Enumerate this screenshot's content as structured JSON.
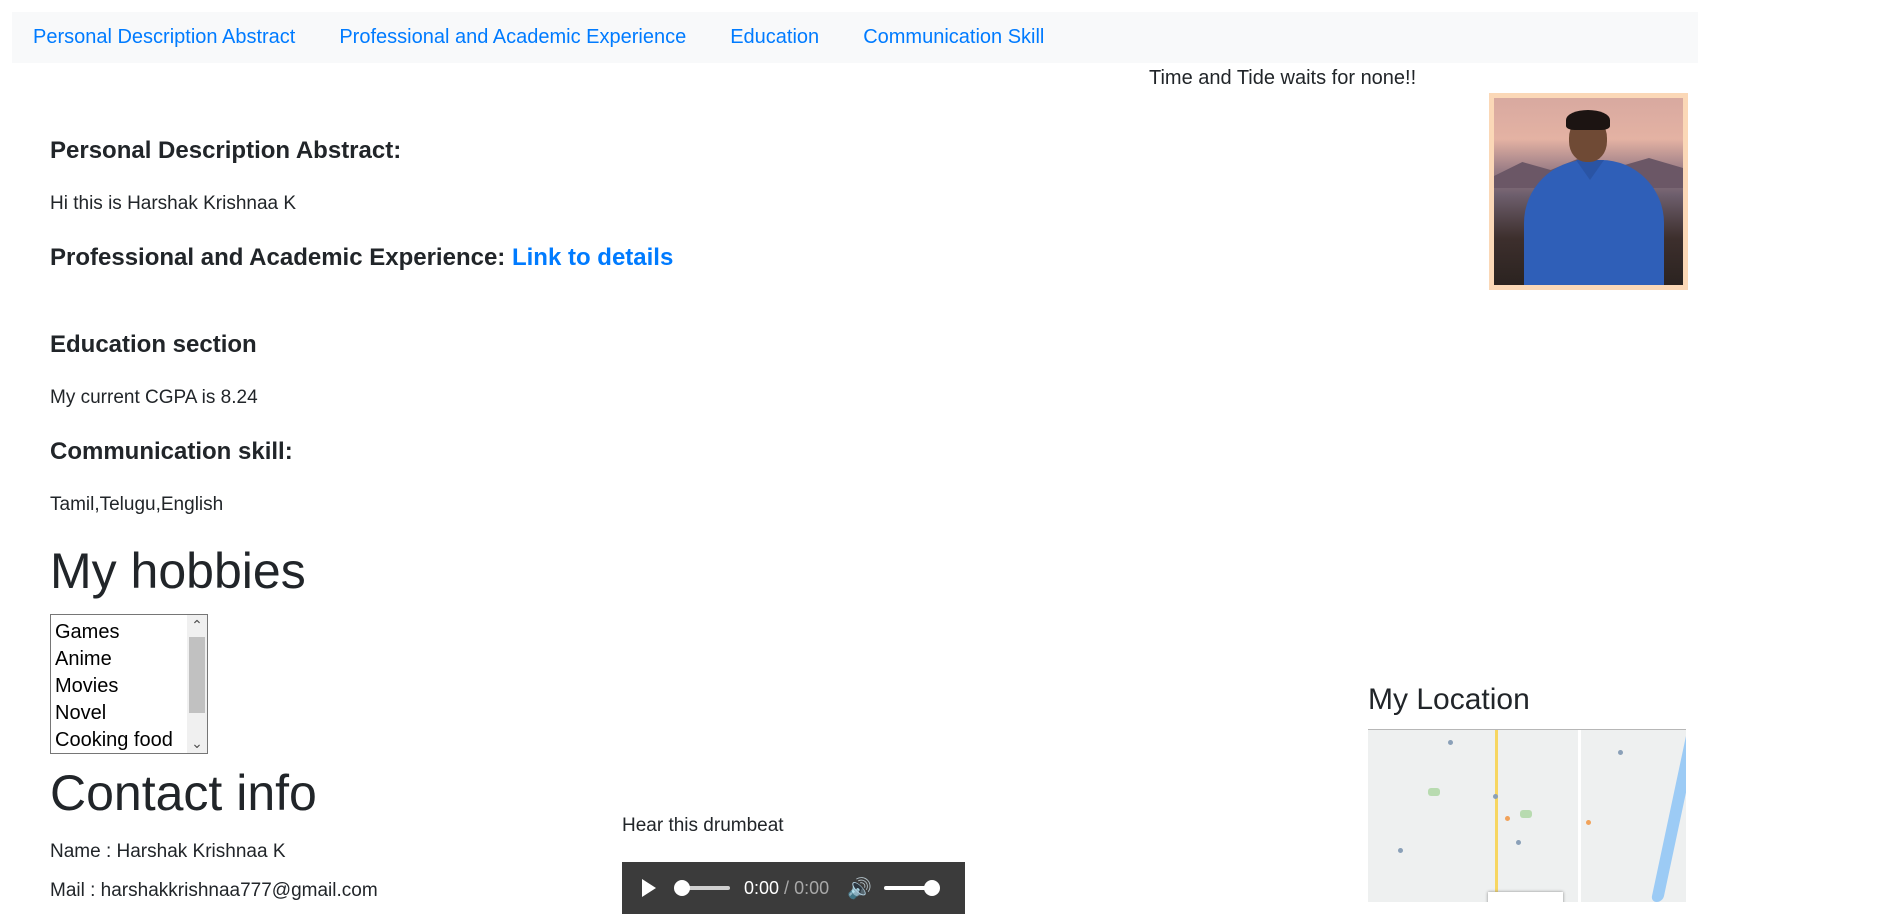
{
  "nav": {
    "items": [
      {
        "label": "Personal Description Abstract"
      },
      {
        "label": "Professional and Academic Experience"
      },
      {
        "label": "Education"
      },
      {
        "label": "Communication Skill"
      }
    ]
  },
  "quote": "Time and Tide waits for none!!",
  "sections": {
    "personal_heading": "Personal Description Abstract:",
    "personal_text": "Hi this is Harshak Krishnaa K",
    "experience_heading": "Professional and Academic Experience: ",
    "experience_link": "Link to details",
    "education_heading": "Education section",
    "education_text": "My current CGPA is 8.24",
    "communication_heading": "Communication skill:",
    "communication_text": "Tamil,Telugu,English"
  },
  "hobbies": {
    "heading": "My hobbies",
    "options": [
      "Games",
      "Anime",
      "Movies",
      "Novel",
      "Cooking food"
    ]
  },
  "contact": {
    "heading": "Contact info",
    "name": "Name : Harshak Krishnaa K",
    "mail": "Mail : harshakkrishnaa777@gmail.com"
  },
  "audio": {
    "caption": "Hear this drumbeat",
    "current_time": "0:00",
    "separator": " / ",
    "duration": "0:00",
    "progress": 0,
    "volume": 1
  },
  "location": {
    "heading": "My Location"
  }
}
